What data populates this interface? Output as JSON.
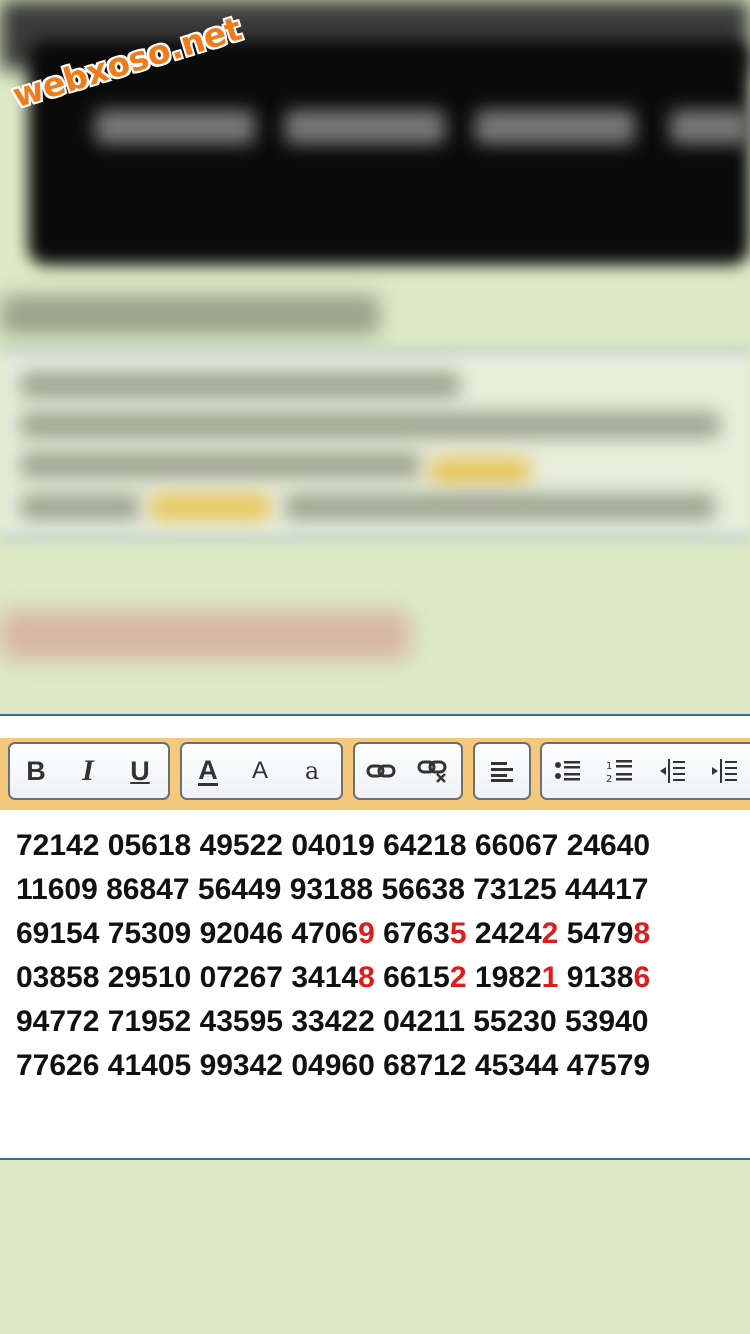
{
  "watermark": {
    "text": "webxoso.net"
  },
  "toolbar": {
    "groups": [
      [
        "bold-icon",
        "italic-icon",
        "underline-icon"
      ],
      [
        "font-color-icon",
        "font-size-icon",
        "font-style-icon"
      ],
      [
        "link-icon",
        "unlink-icon"
      ],
      [
        "align-left-icon"
      ],
      [
        "bulleted-list-icon",
        "numbered-list-icon",
        "outdent-icon",
        "indent-icon"
      ]
    ],
    "labels": {
      "bold": "B",
      "italic": "I",
      "underline": "U",
      "font_color": "A",
      "font_size": "A",
      "font_style": "a"
    }
  },
  "content": {
    "accent_color": "#e01b1b",
    "rows": [
      [
        [
          "72142",
          ""
        ],
        [
          "05618",
          ""
        ],
        [
          "49522",
          ""
        ],
        [
          "04019",
          ""
        ],
        [
          "64218",
          ""
        ],
        [
          "66067",
          ""
        ],
        [
          "24640",
          ""
        ]
      ],
      [
        [
          "11609",
          ""
        ],
        [
          "86847",
          ""
        ],
        [
          "56449",
          ""
        ],
        [
          "93188",
          ""
        ],
        [
          "56638",
          ""
        ],
        [
          "73125",
          ""
        ],
        [
          "44417",
          ""
        ]
      ],
      [
        [
          "69154",
          ""
        ],
        [
          "75309",
          ""
        ],
        [
          "92046",
          ""
        ],
        [
          "4706",
          "9"
        ],
        [
          "6763",
          "5"
        ],
        [
          "2424",
          "2"
        ],
        [
          "5479",
          "8"
        ]
      ],
      [
        [
          "03858",
          ""
        ],
        [
          "29510",
          ""
        ],
        [
          "07267",
          ""
        ],
        [
          "3414",
          "8"
        ],
        [
          "6615",
          "2"
        ],
        [
          "1982",
          "1"
        ],
        [
          "9138",
          "6"
        ]
      ],
      [
        [
          "94772",
          ""
        ],
        [
          "71952",
          ""
        ],
        [
          "43595",
          ""
        ],
        [
          "33422",
          ""
        ],
        [
          "04211",
          ""
        ],
        [
          "55230",
          ""
        ],
        [
          "53940"
        ]
      ],
      [
        [
          "77626",
          ""
        ],
        [
          "41405",
          ""
        ],
        [
          "99342",
          ""
        ],
        [
          "04960",
          ""
        ],
        [
          "68712",
          ""
        ],
        [
          "45344",
          ""
        ],
        [
          "47579",
          ""
        ]
      ]
    ]
  }
}
